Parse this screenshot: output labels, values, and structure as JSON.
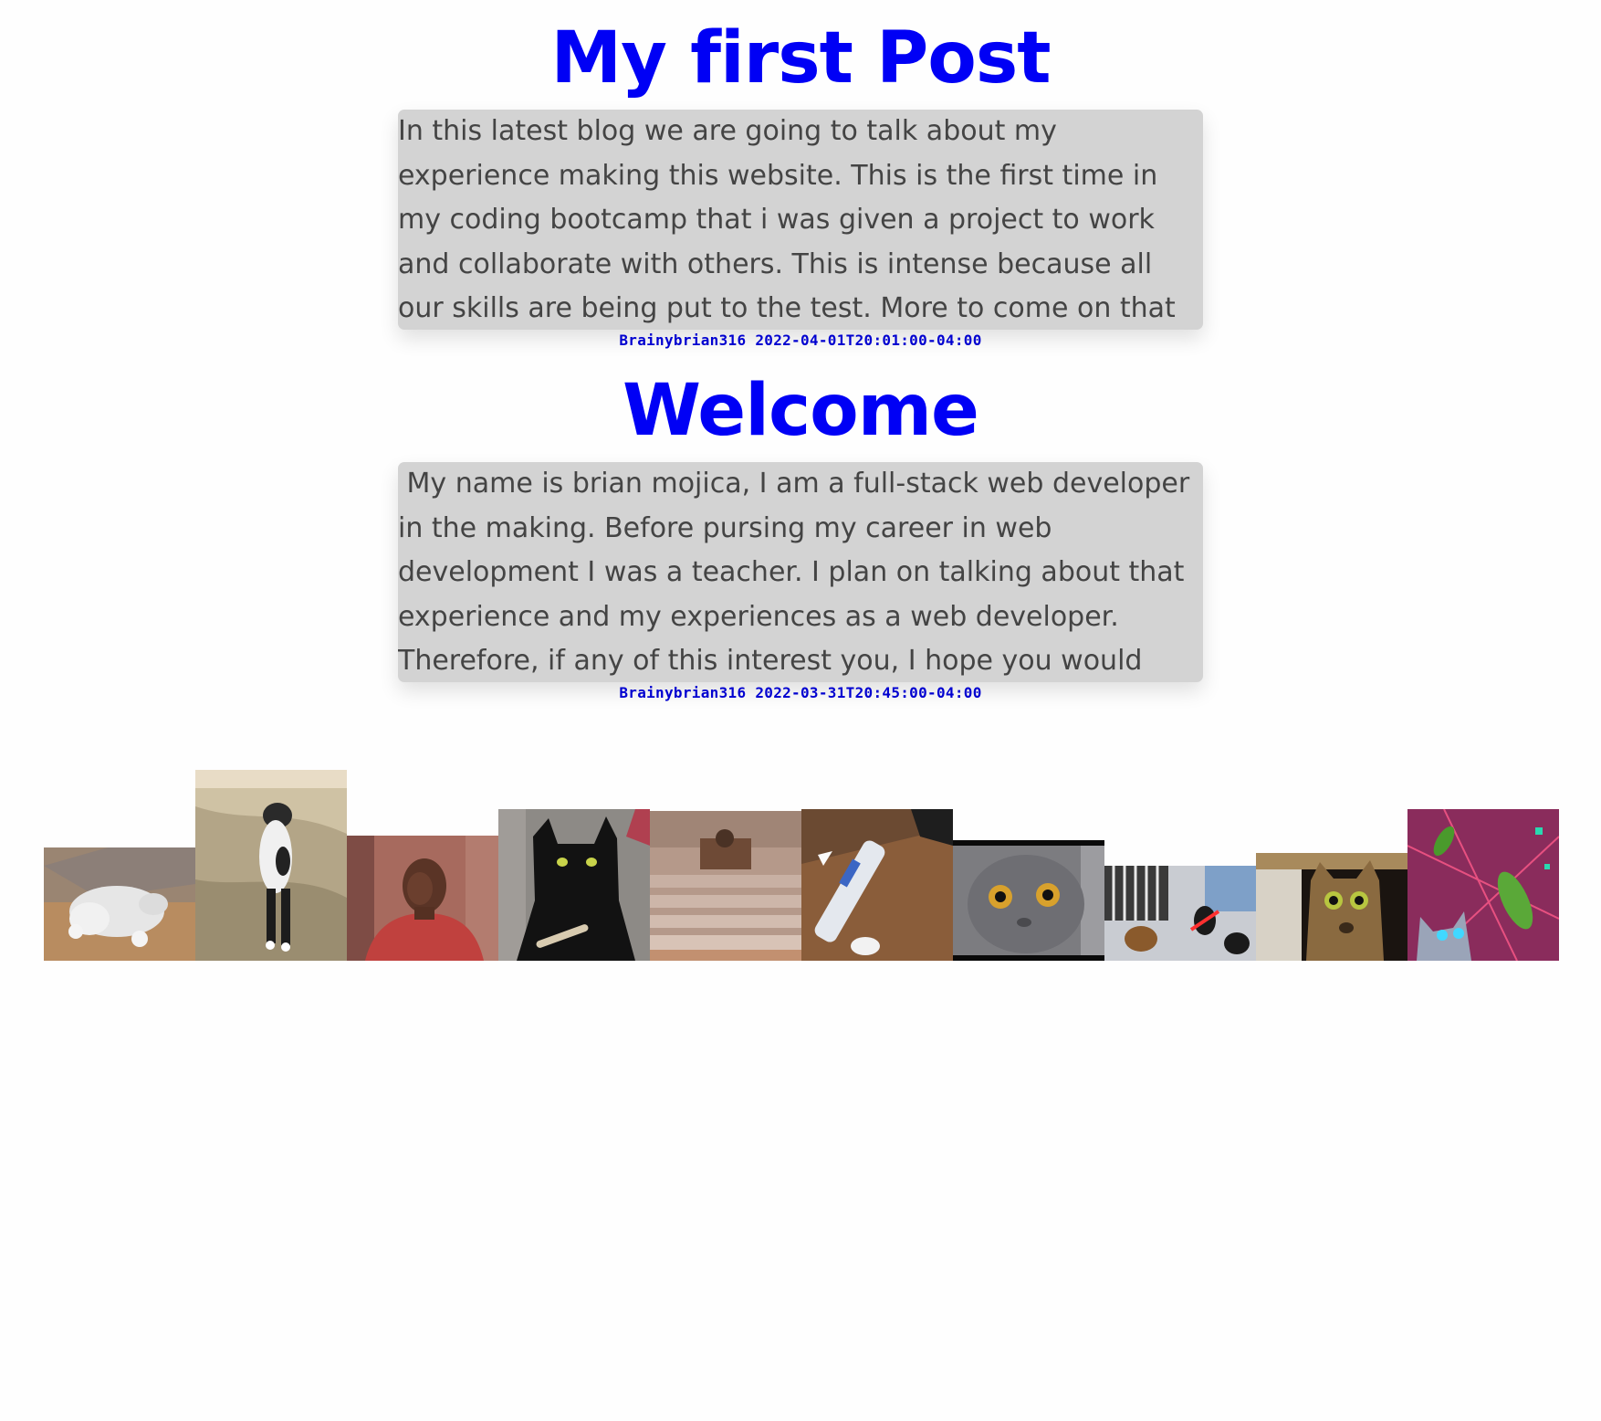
{
  "posts": [
    {
      "title": "My first Post",
      "body": "In this latest blog we are going to talk about my experience making this website. This is the first time in my coding bootcamp that i was given a project to work and collaborate with others. This is intense because all our skills are being put to the test. More to come on that soon....",
      "author": "Brainybrian316",
      "date": "2022-04-01T20:01:00-04:00"
    },
    {
      "title": "Welcome",
      "body": " My name is brian mojica, I am a full-stack web developer in the making. Before pursing my career in web development I was a teacher. I plan on talking about that experience and my experiences as a web developer. Therefore, if any of this interest you, I hope you would tune in for more.",
      "author": "Brainybrian316",
      "date": "2022-03-31T20:45:00-04:00"
    }
  ],
  "gallery": [
    {
      "name": "white-cat-rolling-gif"
    },
    {
      "name": "standing-cat-gif"
    },
    {
      "name": "man-red-shirt-gif"
    },
    {
      "name": "black-cat-gif"
    },
    {
      "name": "cat-in-box-stairs-gif"
    },
    {
      "name": "cat-vacuum-gif"
    },
    {
      "name": "grey-cat-surprised-gif"
    },
    {
      "name": "cats-lightsaber-gif"
    },
    {
      "name": "tabby-cat-surprised-gif"
    },
    {
      "name": "space-cat-pickles-gif"
    }
  ]
}
